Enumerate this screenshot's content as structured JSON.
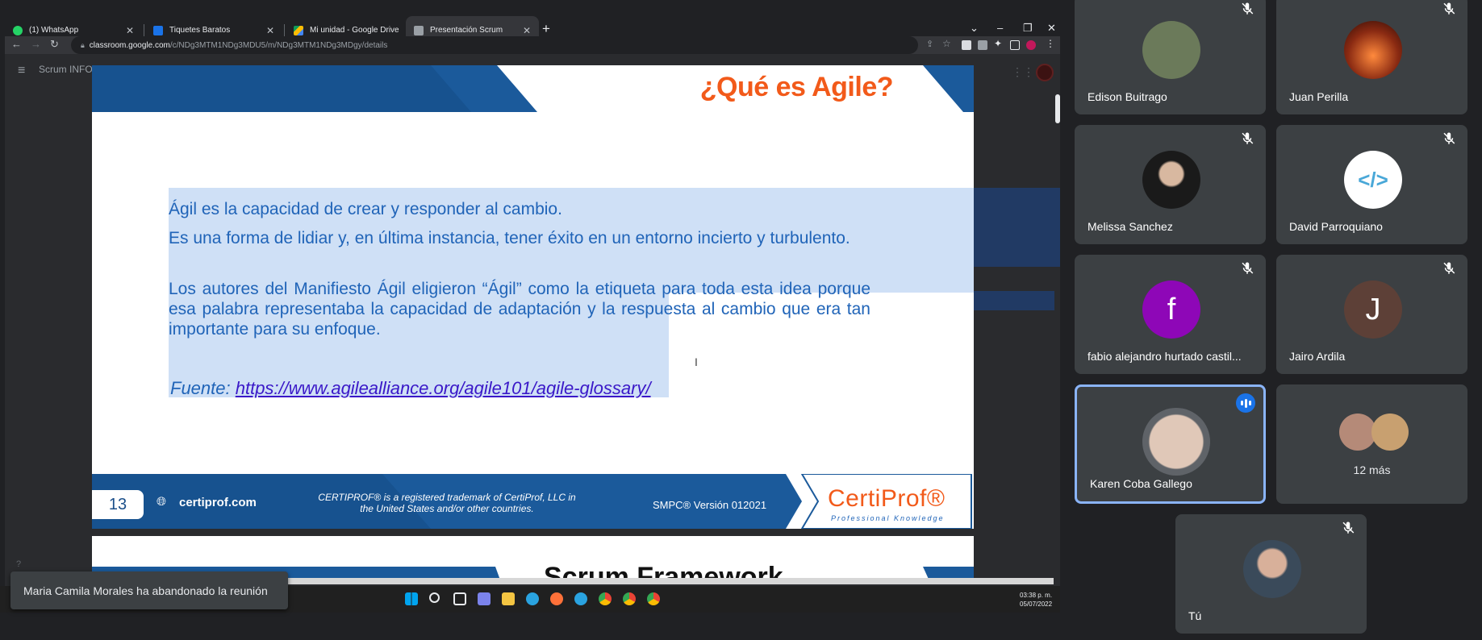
{
  "browser": {
    "tabs": [
      {
        "label": "(1) WhatsApp",
        "color": "#25d366"
      },
      {
        "label": "Tiquetes Baratos",
        "color": "#1a73e8"
      },
      {
        "label": "Mi unidad - Google Drive",
        "color": "#fbbc04"
      },
      {
        "label": "Presentación Scrum",
        "color": "#9aa0a6"
      }
    ],
    "close_glyph": "✕",
    "new_tab": "+",
    "url_host": "classroom.google.com",
    "url_path": "/c/NDg3MTM1NDg3MDU5/m/NDg3MTM1NDg3MDgy/details"
  },
  "classroom": {
    "title": "Scrum INFO"
  },
  "slide": {
    "title": "¿Qué es Agile?",
    "paragraphs": [
      "Ágil es la capacidad de crear y responder al cambio.",
      "Es una forma de lidiar y, en última instancia, tener éxito en un entorno incierto y turbulento.",
      "Los autores del Manifiesto Ágil eligieron “Ágil” como la etiqueta para toda esta idea porque esa palabra representaba la capacidad de adaptación y la respuesta al cambio que era tan importante para su enfoque."
    ],
    "source_label": "Fuente:",
    "source_link": "https://www.agilealliance.org/agile101/agile-glossary/",
    "footer": {
      "page_number": "13",
      "site": "certiprof.com",
      "trademark": "CERTIPROF® is a registered trademark of CertiProf, LLC in the United States and/or other countries.",
      "version": "SMPC® Versión 012021",
      "logo_text": "CertiProf®",
      "logo_sub": "Professional Knowledge"
    },
    "next_slide_title_partial": "Scrum Framework"
  },
  "toast": {
    "message": "Maria Camila Morales ha abandonado la reunión"
  },
  "taskbar": {
    "time": "03:38 p. m.",
    "date": "05/07/2022"
  },
  "participants": [
    {
      "name": "Edison Buitrago",
      "muted": true,
      "avatar_color": "#6b7a5a"
    },
    {
      "name": "Juan Perilla",
      "muted": true,
      "avatar_color": "#8a2a12"
    },
    {
      "name": "Melissa Sanchez",
      "muted": true,
      "avatar_color": "#2a2a2a"
    },
    {
      "name": "David Parroquiano",
      "muted": true,
      "avatar_color": "#ffffff",
      "initial": "</>"
    },
    {
      "name": "fabio alejandro hurtado castil...",
      "muted": true,
      "avatar_color": "#8e07b7",
      "initial": "f"
    },
    {
      "name": "Jairo Ardila",
      "muted": true,
      "avatar_color": "#5d4037",
      "initial": "J"
    },
    {
      "name": "Karen Coba Gallego",
      "muted": false,
      "speaking": true,
      "avatar_color": "#6b6b6b"
    },
    {
      "more_label": "12 más"
    },
    {
      "name": "Tú",
      "muted": true,
      "avatar_color": "#7a8a9a"
    }
  ],
  "colors": {
    "slide_blue": "#1b5a9b",
    "title_orange": "#f25a1a",
    "text_blue": "#2064b8",
    "selection": "#cfe0f6",
    "meet_bg": "#202124",
    "tile_bg": "#3c4043",
    "speaking_border": "#8ab4f8"
  }
}
